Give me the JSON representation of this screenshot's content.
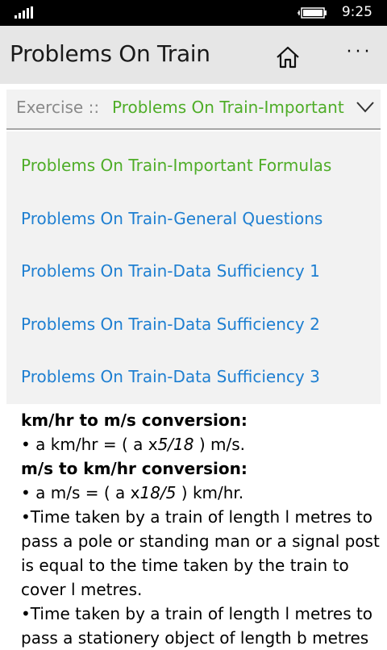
{
  "status": {
    "time": "9:25"
  },
  "header": {
    "title": "Problems On Train",
    "home_icon": "home-icon",
    "more_label": "···"
  },
  "exercise": {
    "label": "Exercise ::",
    "selected": "Problems On Train-Important Formulas",
    "chevron_icon": "chevron-down-icon"
  },
  "dropdown": {
    "items": [
      {
        "label": "Problems On Train-Important Formulas",
        "color": "#4fad28"
      },
      {
        "label": "Problems On Train-General Questions",
        "color": "#1e7fd1"
      },
      {
        "label": "Problems On Train-Data Sufficiency 1",
        "color": "#1e7fd1"
      },
      {
        "label": "Problems On Train-Data Sufficiency 2",
        "color": "#1e7fd1"
      },
      {
        "label": "Problems On Train-Data Sufficiency 3",
        "color": "#1e7fd1"
      }
    ]
  },
  "content": {
    "h1": "km/hr to m/s conversion:",
    "l1_pre": "• a km/hr = ( a x",
    "l1_frac": "5/18",
    "l1_post": " ) m/s.",
    "h2": "m/s to km/hr conversion:",
    "l2_pre": "• a m/s = ( a x",
    "l2_frac": "18/5",
    "l2_post": " ) km/hr.",
    "p1": "•Time taken by a train of length l metres to pass a pole or standing man or a signal post is equal to the time taken by the train to cover l metres.",
    "p2": "•Time taken by a train of length l metres to pass a stationery object of length b metres"
  },
  "colors": {
    "accent_green": "#4fad28",
    "link_blue": "#1e7fd1"
  }
}
